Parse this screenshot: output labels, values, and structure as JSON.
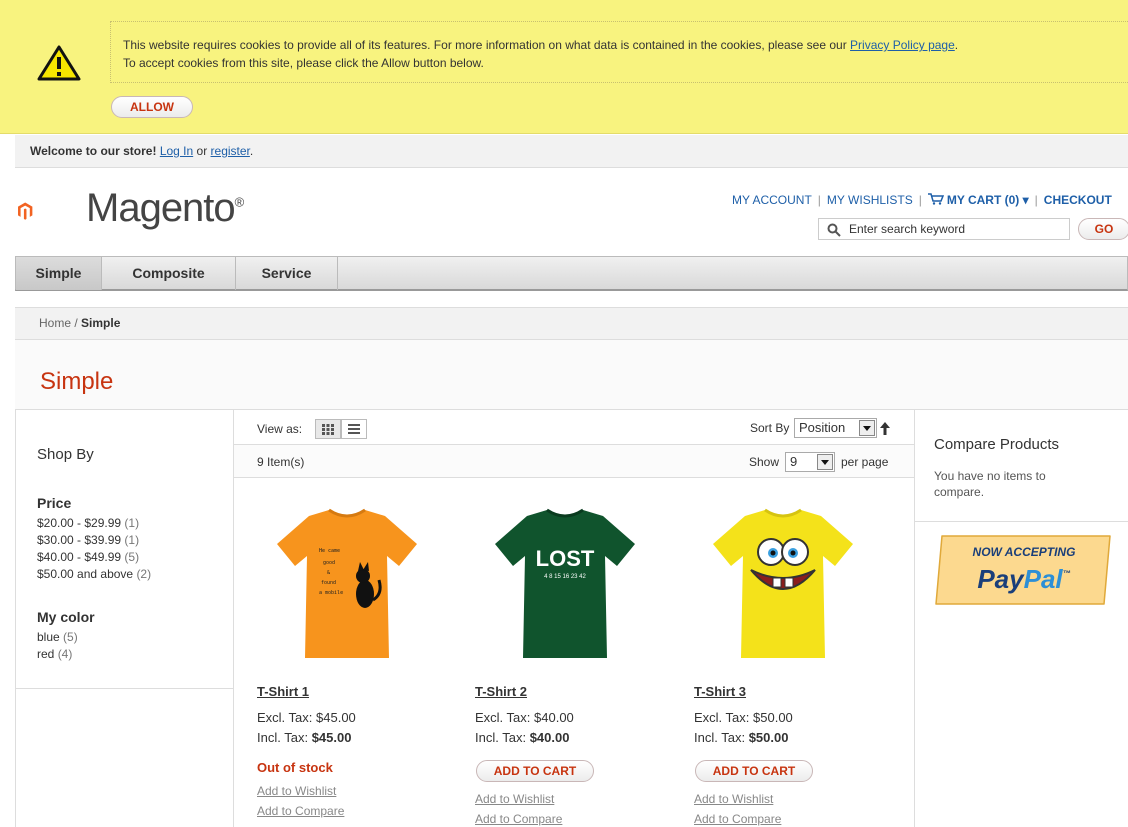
{
  "cookie": {
    "line1": "This website requires cookies to provide all of its features. For more information on what data is contained in the cookies, please see our ",
    "policy_link": "Privacy Policy page",
    "line1_end": ".",
    "line2": "To accept cookies from this site, please click the Allow button below.",
    "allow_label": "ALLOW"
  },
  "welcome": {
    "text": "Welcome to our store!",
    "login": "Log In",
    "or": " or ",
    "register": "register",
    "end": "."
  },
  "header": {
    "logo_text": "Magento",
    "logo_mark": "®",
    "links": {
      "account": "MY ACCOUNT",
      "wishlists": "MY WISHLISTS",
      "cart": "MY CART (0) ▾",
      "checkout": "CHECKOUT"
    },
    "search": {
      "placeholder": "Enter search keyword",
      "go": "GO"
    }
  },
  "nav": {
    "items": [
      "Simple",
      "Composite",
      "Service"
    ],
    "active": "Simple"
  },
  "breadcrumb": {
    "home": "Home",
    "sep": " / ",
    "current": "Simple"
  },
  "page_title": "Simple",
  "sidebar": {
    "title": "Shop By",
    "price": {
      "heading": "Price",
      "items": [
        {
          "label": "$20.00 - $29.99",
          "count": "(1)"
        },
        {
          "label": "$30.00 - $39.99",
          "count": "(1)"
        },
        {
          "label": "$40.00 - $49.99",
          "count": "(5)"
        },
        {
          "label": "$50.00 and above",
          "count": "(2)"
        }
      ]
    },
    "color": {
      "heading": "My color",
      "items": [
        {
          "label": "blue",
          "count": "(5)"
        },
        {
          "label": "red",
          "count": "(4)"
        }
      ]
    }
  },
  "toolbar": {
    "view_as": "View as:",
    "sort_by": "Sort By",
    "sort_value": "Position",
    "items_count": "9 Item(s)",
    "show": "Show",
    "show_value": "9",
    "per_page": "per page"
  },
  "products": [
    {
      "name": "T-Shirt 1",
      "excl_label": "Excl. Tax:",
      "excl": "$45.00",
      "incl_label": "Incl. Tax:",
      "incl": "$45.00",
      "status": "Out of stock",
      "color": "#f7941d",
      "print": "He came / good / & / found / a mobile",
      "wishlist": "Add to Wishlist",
      "compare": "Add to Compare"
    },
    {
      "name": "T-Shirt 2",
      "excl_label": "Excl. Tax:",
      "excl": "$40.00",
      "incl_label": "Incl. Tax:",
      "incl": "$40.00",
      "button": "ADD TO CART",
      "color": "#10542d",
      "print": "LOST",
      "print2": "4 8 15 16 23 42",
      "wishlist": "Add to Wishlist",
      "compare": "Add to Compare"
    },
    {
      "name": "T-Shirt 3",
      "excl_label": "Excl. Tax:",
      "excl": "$50.00",
      "incl_label": "Incl. Tax:",
      "incl": "$50.00",
      "button": "ADD TO CART",
      "color": "#f4e21a",
      "wishlist": "Add to Wishlist",
      "compare": "Add to Compare"
    }
  ],
  "right": {
    "compare_title": "Compare Products",
    "compare_text": "You have no items to compare.",
    "paypal_top": "NOW ACCEPTING",
    "paypal_pay": "Pay",
    "paypal_pal": "Pal",
    "paypal_tm": "™"
  },
  "colors": {
    "accent": "#c73410",
    "link": "#1e5fa8",
    "cookie_bg": "#f8f37f"
  }
}
